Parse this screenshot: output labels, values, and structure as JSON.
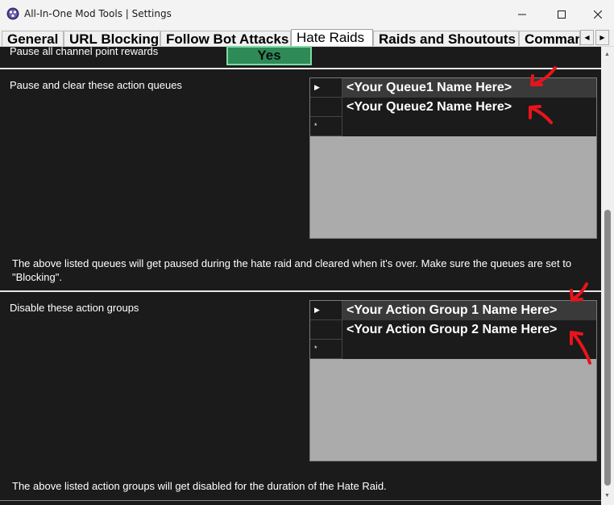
{
  "window": {
    "title": "All-In-One Mod Tools | Settings",
    "icon": "app-logo-icon",
    "controls": [
      "minimize-icon",
      "maximize-icon",
      "close-icon"
    ]
  },
  "tabs": [
    {
      "label": "General",
      "selected": false
    },
    {
      "label": "URL Blocking",
      "selected": false
    },
    {
      "label": "Follow Bot Attacks",
      "selected": false
    },
    {
      "label": "Hate Raids",
      "selected": true
    },
    {
      "label": "Raids and Shoutouts",
      "selected": false
    },
    {
      "label": "Comman",
      "selected": false
    }
  ],
  "tab_scroll": {
    "left": "◀",
    "right": "▶"
  },
  "settings": {
    "pause_rewards": {
      "label": "Pause all channel point rewards",
      "value": "Yes"
    },
    "queues": {
      "label": "Pause and clear these action queues",
      "rows": [
        "<Your Queue1 Name Here>",
        "<Your Queue2 Name Here>"
      ],
      "row_markers": [
        "▶",
        "",
        "*"
      ],
      "description": "The above listed queues will get paused during the hate raid and cleared when it's over. Make sure the queues are set to \"Blocking\"."
    },
    "action_groups": {
      "label": "Disable these action groups",
      "rows": [
        "<Your Action Group 1 Name Here>",
        "<Your Action Group 2 Name Here>"
      ],
      "row_markers": [
        "▶",
        "",
        "*"
      ],
      "description": "The above listed action groups will get disabled for the duration of the Hate Raid."
    }
  },
  "colors": {
    "background": "#1b1b1b",
    "yes_button": "#2e8b57",
    "annotation_arrow": "#e8141c"
  }
}
